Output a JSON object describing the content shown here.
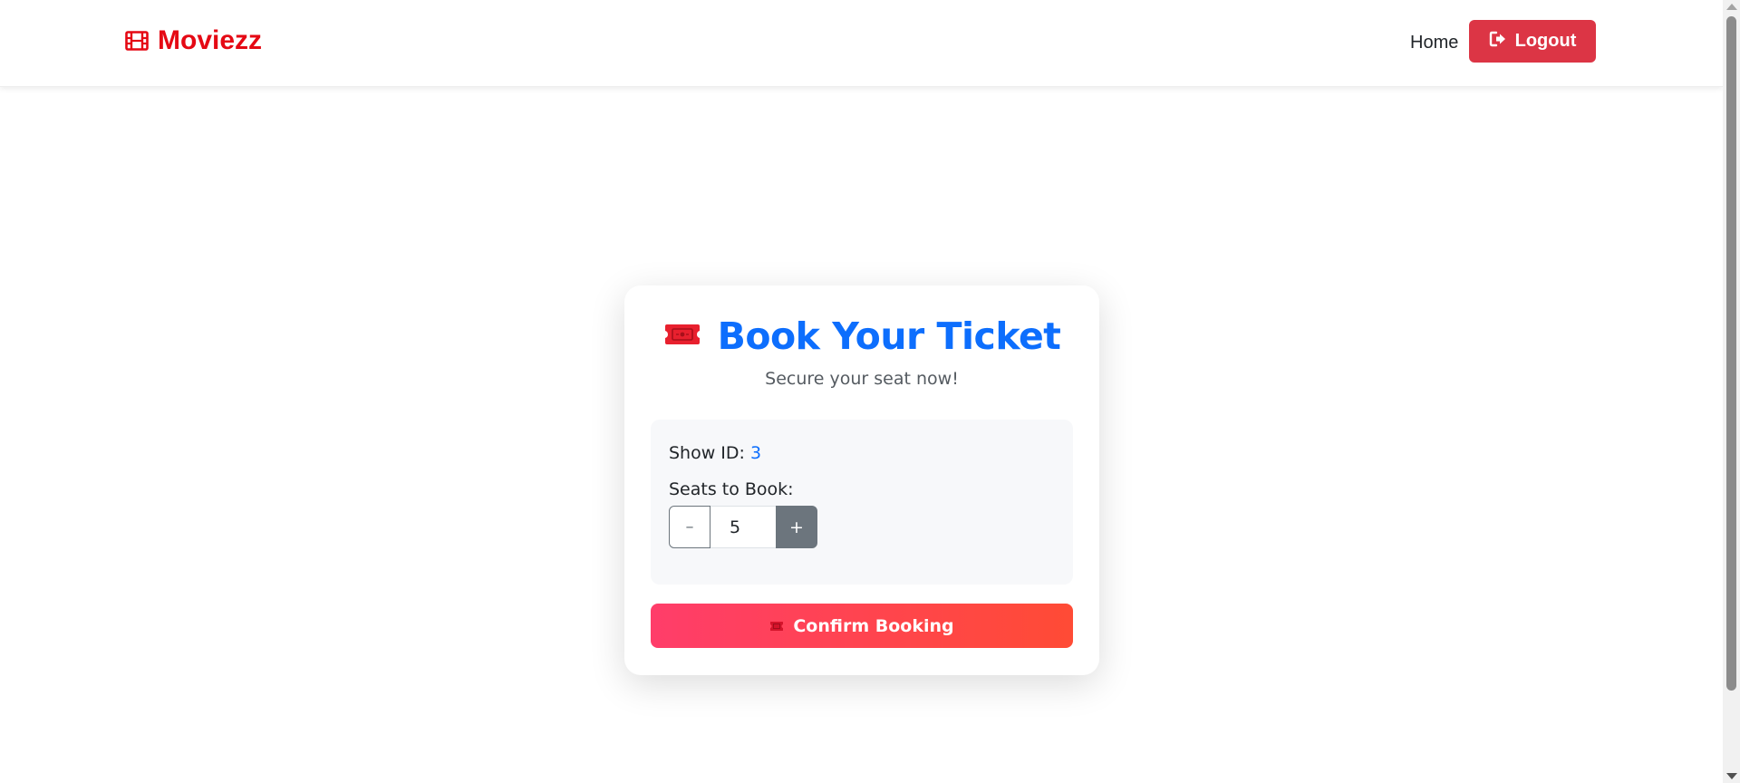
{
  "navbar": {
    "brand_name": "Moviezz",
    "brand_icon": "film-icon",
    "home_label": "Home",
    "logout_label": "Logout",
    "logout_icon": "logout-icon",
    "brand_color": "#e50914",
    "logout_color": "#dc3545"
  },
  "booking": {
    "title": "Book Your Ticket",
    "title_icon": "ticket-icon",
    "title_color": "#0d6efd",
    "subtitle": "Secure your seat now!",
    "show_id_label": "Show ID:",
    "show_id_value": "3",
    "seats_label": "Seats to Book:",
    "seats_value": "5",
    "minus_label": "–",
    "plus_label": "+",
    "confirm_label": "Confirm Booking",
    "confirm_icon": "ticket-icon"
  }
}
